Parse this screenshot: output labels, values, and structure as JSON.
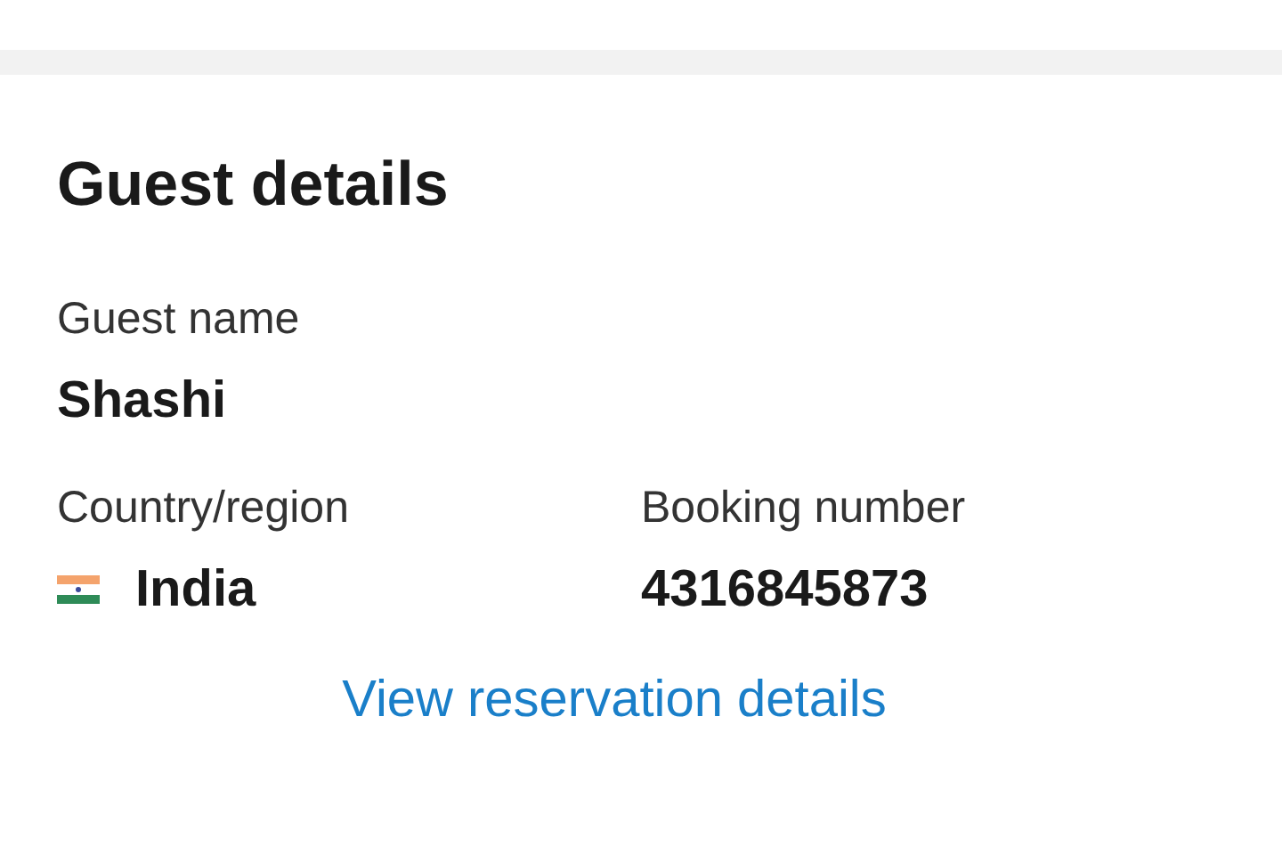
{
  "section": {
    "title": "Guest details"
  },
  "fields": [
    {
      "label": "Guest name",
      "value": "Shashi",
      "kind": "text"
    },
    {
      "label": "Country/region",
      "value": "India",
      "kind": "country"
    },
    {
      "label": "Booking number",
      "value": "4316845873",
      "kind": "text"
    }
  ],
  "link": "View reservation details"
}
